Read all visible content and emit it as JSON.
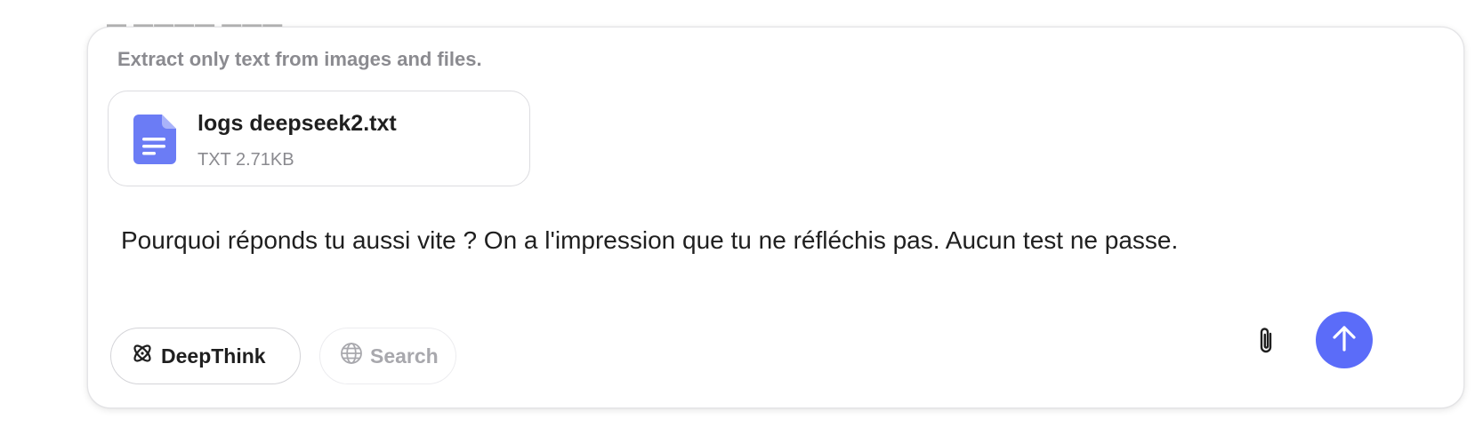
{
  "composer": {
    "hint": "Extract only text from images and files.",
    "attachment": {
      "icon": "document-icon",
      "name": "logs deepseek2.txt",
      "meta": "TXT 2.71KB"
    },
    "message": "Pourquoi réponds tu aussi vite ? On a l'impression que tu ne réfléchis pas. Aucun test ne passe.",
    "toolbar": {
      "deepthink_label": "DeepThink",
      "deepthink_icon": "atom-icon",
      "search_label": "Search",
      "search_icon": "globe-icon",
      "attach_icon": "paperclip-icon",
      "send_icon": "arrow-up-icon"
    }
  },
  "colors": {
    "accent": "#5b6cf9",
    "file_icon": "#6b7cf5",
    "hint_text": "#8b8b90",
    "muted_text": "#a8a8ad"
  }
}
